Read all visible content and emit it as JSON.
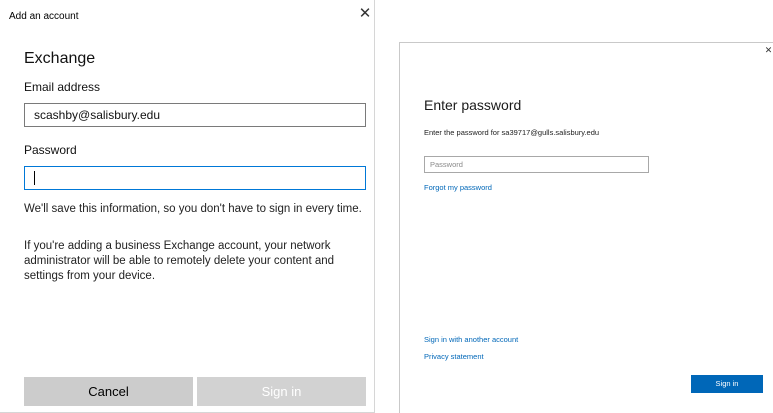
{
  "left_dialog": {
    "title": "Add an account",
    "close_glyph": "✕",
    "heading": "Exchange",
    "email_label": "Email address",
    "email_value": "scashby@salisbury.edu",
    "password_label": "Password",
    "password_value": "",
    "info_1": "We'll save this information, so you don't have to sign in every time.",
    "info_2": "If you're adding a business Exchange account, your network administrator will be able to remotely delete your content and settings from your device.",
    "cancel_label": "Cancel",
    "signin_label": "Sign in"
  },
  "right_dialog": {
    "close_glyph": "✕",
    "heading": "Enter password",
    "subtitle": "Enter the password for sa39717@gulls.salisbury.edu",
    "password_placeholder": "Password",
    "forgot_link": "Forgot my password",
    "other_account_link": "Sign in with another account",
    "privacy_link": "Privacy statement",
    "signin_label": "Sign in"
  }
}
